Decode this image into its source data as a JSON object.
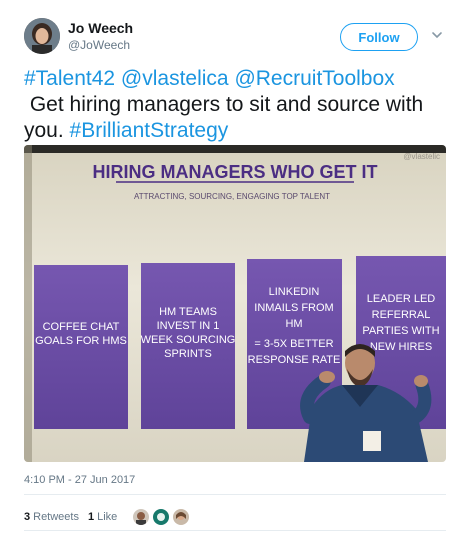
{
  "author": {
    "name": "Jo Weech",
    "handle": "@JoWeech"
  },
  "follow_label": "Follow",
  "tweet_text": {
    "tag1": "#Talent42",
    "tag2": "@vlastelica",
    "tag3": "@RecruitToolbox",
    "body": "Get hiring managers to sit and source with you.",
    "tag4": "#BrilliantStrategy"
  },
  "photo": {
    "watermark": "@vlastelic",
    "title": "HIRING MANAGERS WHO GET IT",
    "subtitle": "ATTRACTING, SOURCING, ENGAGING TOP TALENT",
    "cards": [
      [
        "COFFEE CHAT",
        "GOALS FOR HMS"
      ],
      [
        "HM TEAMS",
        "INVEST IN 1",
        "WEEK SOURCING",
        "SPRINTS"
      ],
      [
        "LINKEDIN",
        "INMAILS FROM",
        "HM",
        "= 3-5X BETTER",
        "RESPONSE RATE"
      ],
      [
        "LEADER LED",
        "REFERRAL",
        "PARTIES WITH",
        "NEW HIRES"
      ]
    ],
    "colors": {
      "slide_bg": "#e9e5d6",
      "card": "#6a4ba3",
      "title": "#4b2e83"
    }
  },
  "timestamp": "4:10 PM - 27 Jun 2017",
  "stats": {
    "retweets_count": "3",
    "retweets_label": "Retweets",
    "likes_count": "1",
    "likes_label": "Like"
  },
  "colors": {
    "link": "#1b95e0",
    "accent": "#1da1f2",
    "muted": "#657786"
  }
}
